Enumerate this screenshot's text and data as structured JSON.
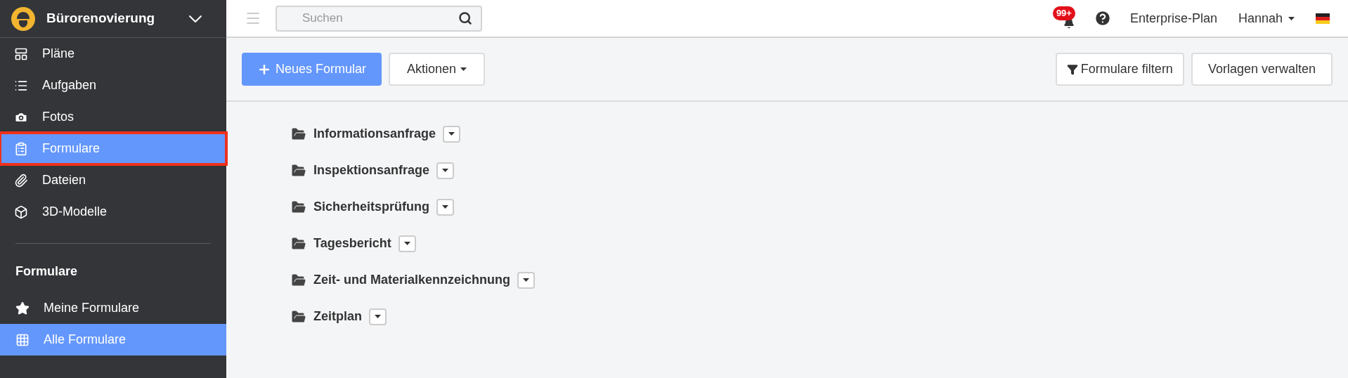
{
  "project": {
    "name": "Bürorenovierung"
  },
  "nav": [
    {
      "label": "Pläne",
      "kind": "plans",
      "selected": false,
      "highlighted": false
    },
    {
      "label": "Aufgaben",
      "kind": "list",
      "selected": false,
      "highlighted": false
    },
    {
      "label": "Fotos",
      "kind": "camera",
      "selected": false,
      "highlighted": false
    },
    {
      "label": "Formulare",
      "kind": "clipboard",
      "selected": true,
      "highlighted": true
    },
    {
      "label": "Dateien",
      "kind": "paperclip",
      "selected": false,
      "highlighted": false
    },
    {
      "label": "3D-Modelle",
      "kind": "cube",
      "selected": false,
      "highlighted": false
    }
  ],
  "section": {
    "title": "Formulare",
    "items": [
      {
        "label": "Meine Formulare",
        "kind": "star",
        "selected": false
      },
      {
        "label": "Alle Formulare",
        "kind": "grid",
        "selected": true
      }
    ]
  },
  "search": {
    "placeholder": "Suchen"
  },
  "topbar": {
    "notification_badge": "99+",
    "plan": "Enterprise-Plan",
    "user": "Hannah"
  },
  "toolbar": {
    "new_button": "Neues Formular",
    "actions_button": "Aktionen",
    "filter_button": "Formulare filtern",
    "templates_button": "Vorlagen verwalten"
  },
  "folders": [
    {
      "name": "Informationsanfrage"
    },
    {
      "name": "Inspektionsanfrage"
    },
    {
      "name": "Sicherheitsprüfung"
    },
    {
      "name": "Tagesbericht"
    },
    {
      "name": "Zeit- und Materialkennzeichnung"
    },
    {
      "name": "Zeitplan"
    }
  ]
}
